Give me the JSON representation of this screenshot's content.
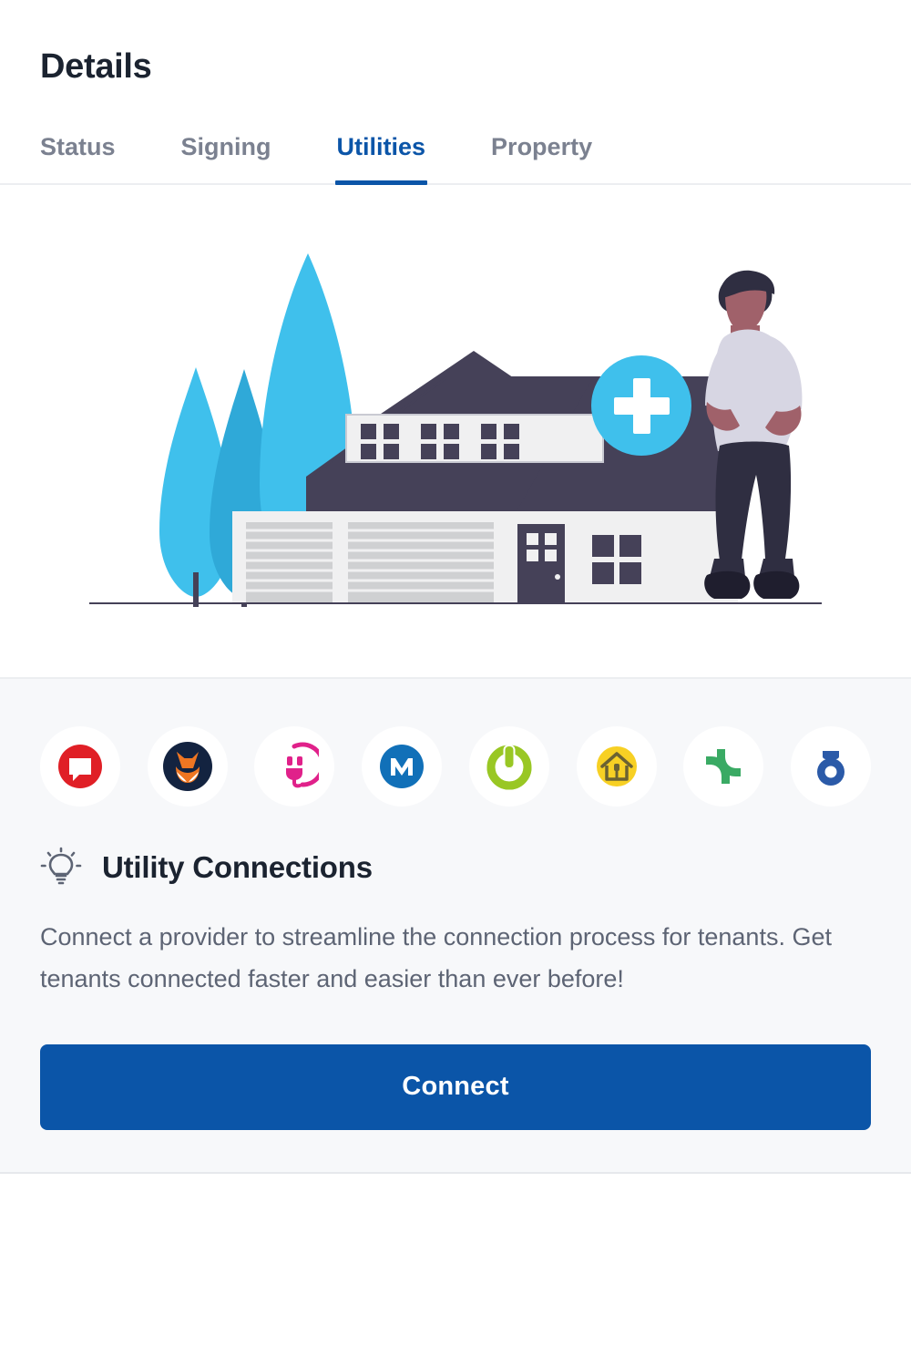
{
  "header": {
    "title": "Details"
  },
  "tabs": [
    {
      "label": "Status",
      "active": false
    },
    {
      "label": "Signing",
      "active": false
    },
    {
      "label": "Utilities",
      "active": true
    },
    {
      "label": "Property",
      "active": false
    }
  ],
  "illustration": {
    "name": "house-with-person-add-illustration",
    "badge_icon": "plus-icon",
    "colors": {
      "cyan": "#3fc0ec",
      "cyan_dark": "#2fa9d8",
      "roof": "#454158",
      "wall": "#f0f0f1",
      "garage": "#cfd0d2",
      "skin": "#a0616a",
      "shirt": "#d7d6e3",
      "pants": "#2f2e41",
      "hair": "#2f2e41"
    }
  },
  "providers": [
    {
      "name": "provider-speech-bubble",
      "icon": "speech-bubble-icon",
      "color": "#e01f26"
    },
    {
      "name": "provider-fox",
      "icon": "fox-face-icon",
      "color": "#ef7622"
    },
    {
      "name": "provider-plug-smiley",
      "icon": "plug-smiley-icon",
      "color": "#e0218a"
    },
    {
      "name": "provider-m-badge",
      "icon": "letter-m-icon",
      "color": "#1170b8"
    },
    {
      "name": "provider-power",
      "icon": "power-button-icon",
      "color": "#99c724"
    },
    {
      "name": "provider-home-plug",
      "icon": "home-plug-icon",
      "color": "#f7d024"
    },
    {
      "name": "provider-green-elbows",
      "icon": "double-elbow-icon",
      "color": "#3aaa64"
    },
    {
      "name": "provider-ring-bar",
      "icon": "ring-bar-icon",
      "color": "#2b5aa8"
    }
  ],
  "section": {
    "icon": "lightbulb-icon",
    "title": "Utility Connections",
    "description": "Connect a provider to streamline the connection process for tenants. Get tenants connected faster and easier than ever before!"
  },
  "actions": {
    "connect_label": "Connect"
  },
  "theme": {
    "accent_blue": "#0b55a8",
    "muted_text": "#7b8190",
    "body_text": "#5d6474",
    "panel_bg": "#f7f8fa",
    "divider": "#eceef1"
  }
}
